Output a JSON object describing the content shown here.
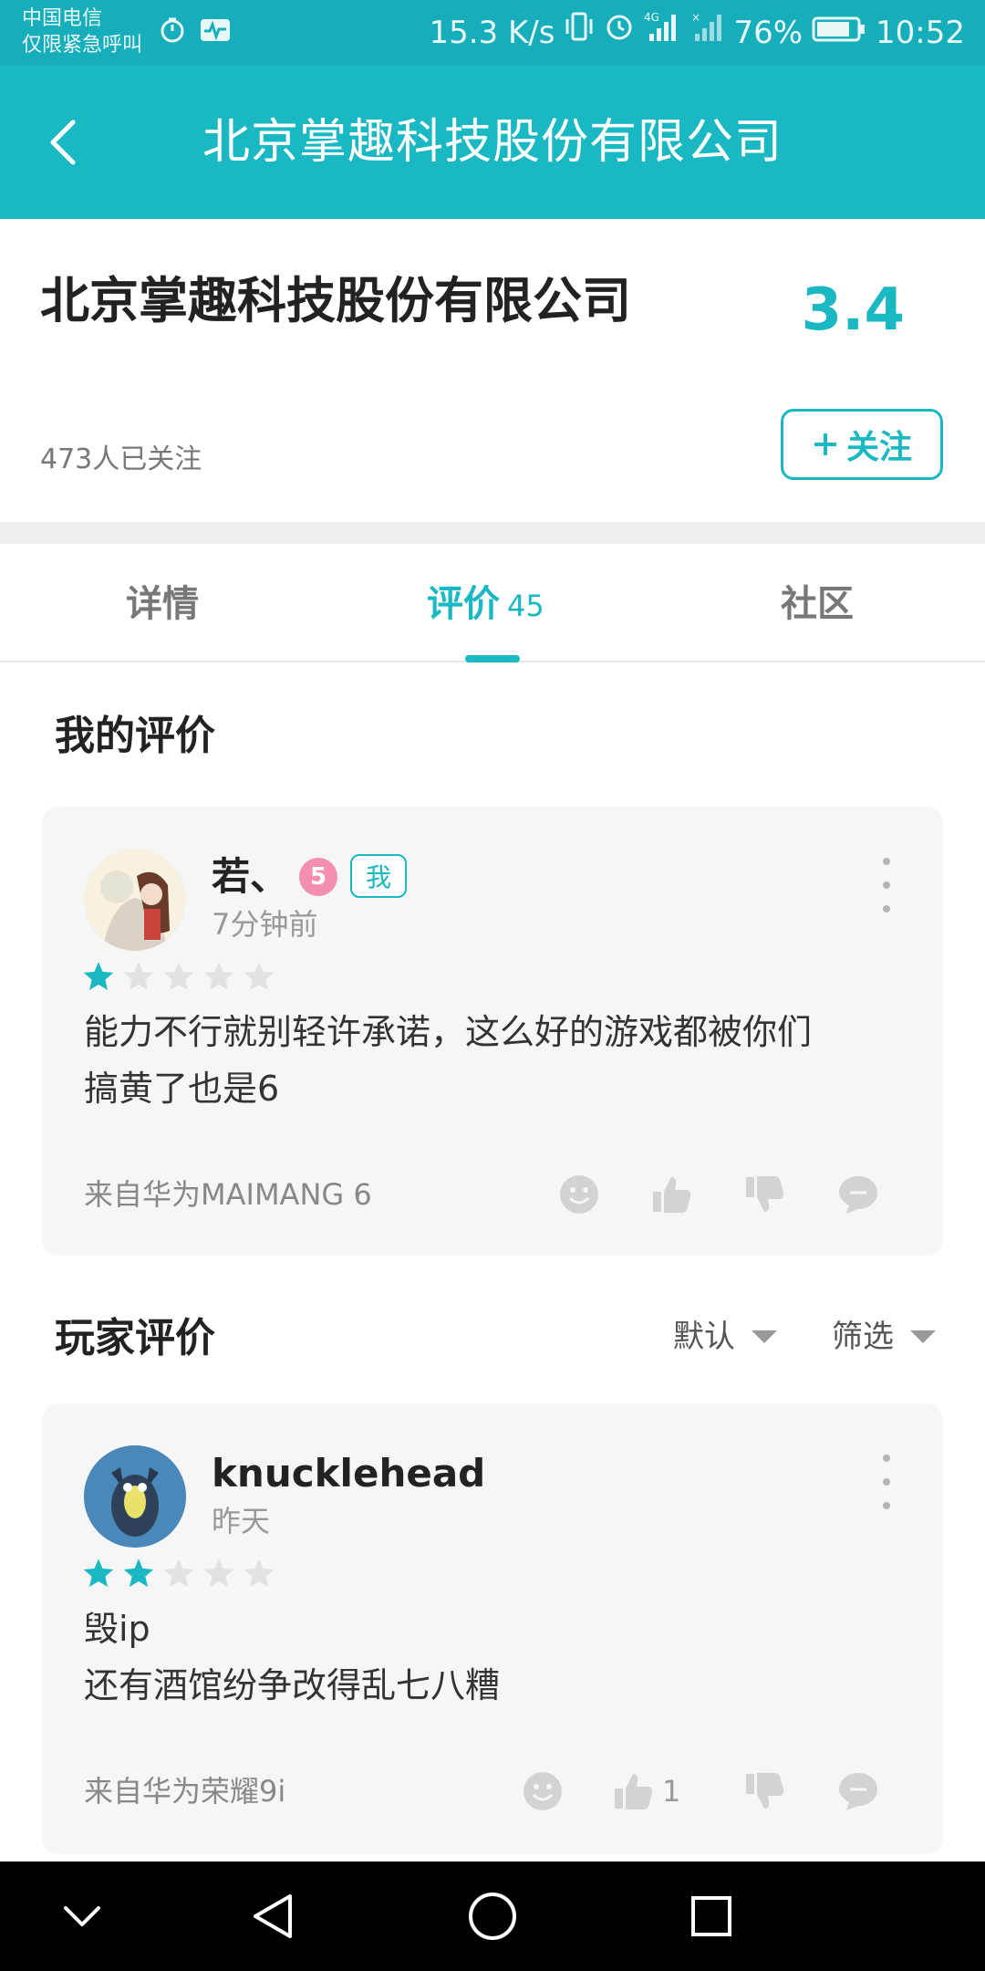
{
  "status_bar": {
    "carrier_line1": "中国电信",
    "carrier_line2": "仅限紧急呼叫",
    "net_speed": "15.3 K/s",
    "network": "4G",
    "battery": "76%",
    "time": "10:52"
  },
  "app_bar": {
    "title": "北京掌趣科技股份有限公司"
  },
  "company": {
    "name": "北京掌趣科技股份有限公司",
    "rating": "3.4",
    "followers": "473人已关注",
    "follow_label": "关注"
  },
  "tabs": {
    "details": "详情",
    "reviews": "评价",
    "reviews_count": "45",
    "community": "社区",
    "active": "reviews"
  },
  "my_review": {
    "section_title": "我的评价",
    "user": "若、",
    "level": "5",
    "me_badge": "我",
    "time": "7分钟前",
    "stars": 1,
    "text": "能力不行就别轻许承诺，这么好的游戏都被你们\n搞黄了也是6",
    "device": "来自华为MAIMANG 6"
  },
  "player_reviews": {
    "section_title": "玩家评价",
    "sort_default": "默认",
    "sort_filter": "筛选",
    "items": [
      {
        "user": "knucklehead",
        "time": "昨天",
        "stars": 2,
        "text": "毁ip\n还有酒馆纷争改得乱七八糟",
        "device": "来自华为荣耀9i",
        "likes": "1"
      }
    ]
  },
  "colors": {
    "accent": "#19b8c3",
    "status_bar": "#16aebb",
    "card_bg": "#f6f6f6"
  }
}
